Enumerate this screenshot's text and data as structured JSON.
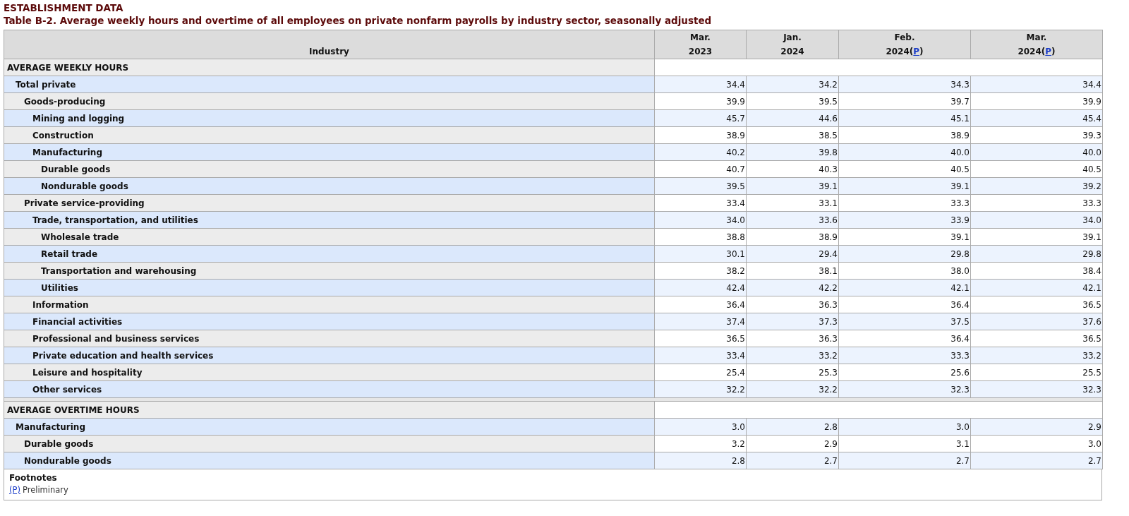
{
  "heading": "ESTABLISHMENT DATA",
  "title": "Table B-2. Average weekly hours and overtime of all employees on private nonfarm payrolls by industry sector, seasonally adjusted",
  "columns": [
    {
      "label": "Industry"
    },
    {
      "month": "Mar.",
      "year": "2023"
    },
    {
      "month": "Jan.",
      "year": "2024"
    },
    {
      "month": "Feb.",
      "year": "2024",
      "footnote": {
        "open": "(",
        "label": "P",
        "close": ")"
      }
    },
    {
      "month": "Mar.",
      "year": "2024",
      "footnote": {
        "open": "(",
        "label": "P",
        "close": ")"
      }
    }
  ],
  "sections": [
    {
      "title": "AVERAGE WEEKLY HOURS",
      "rows": [
        {
          "label": "Total private",
          "values": [
            "34.4",
            "34.2",
            "34.3",
            "34.4"
          ],
          "children": [
            {
              "label": "Goods-producing",
              "values": [
                "39.9",
                "39.5",
                "39.7",
                "39.9"
              ],
              "children": [
                {
                  "label": "Mining and logging",
                  "values": [
                    "45.7",
                    "44.6",
                    "45.1",
                    "45.4"
                  ]
                },
                {
                  "label": "Construction",
                  "values": [
                    "38.9",
                    "38.5",
                    "38.9",
                    "39.3"
                  ]
                },
                {
                  "label": "Manufacturing",
                  "values": [
                    "40.2",
                    "39.8",
                    "40.0",
                    "40.0"
                  ],
                  "children": [
                    {
                      "label": "Durable goods",
                      "values": [
                        "40.7",
                        "40.3",
                        "40.5",
                        "40.5"
                      ]
                    },
                    {
                      "label": "Nondurable goods",
                      "values": [
                        "39.5",
                        "39.1",
                        "39.1",
                        "39.2"
                      ]
                    }
                  ]
                }
              ]
            },
            {
              "label": "Private service-providing",
              "values": [
                "33.4",
                "33.1",
                "33.3",
                "33.3"
              ],
              "children": [
                {
                  "label": "Trade, transportation, and utilities",
                  "values": [
                    "34.0",
                    "33.6",
                    "33.9",
                    "34.0"
                  ],
                  "children": [
                    {
                      "label": "Wholesale trade",
                      "values": [
                        "38.8",
                        "38.9",
                        "39.1",
                        "39.1"
                      ]
                    },
                    {
                      "label": "Retail trade",
                      "values": [
                        "30.1",
                        "29.4",
                        "29.8",
                        "29.8"
                      ]
                    },
                    {
                      "label": "Transportation and warehousing",
                      "values": [
                        "38.2",
                        "38.1",
                        "38.0",
                        "38.4"
                      ]
                    },
                    {
                      "label": "Utilities",
                      "values": [
                        "42.4",
                        "42.2",
                        "42.1",
                        "42.1"
                      ]
                    }
                  ]
                },
                {
                  "label": "Information",
                  "values": [
                    "36.4",
                    "36.3",
                    "36.4",
                    "36.5"
                  ]
                },
                {
                  "label": "Financial activities",
                  "values": [
                    "37.4",
                    "37.3",
                    "37.5",
                    "37.6"
                  ]
                },
                {
                  "label": "Professional and business services",
                  "values": [
                    "36.5",
                    "36.3",
                    "36.4",
                    "36.5"
                  ]
                },
                {
                  "label": "Private education and health services",
                  "values": [
                    "33.4",
                    "33.2",
                    "33.3",
                    "33.2"
                  ]
                },
                {
                  "label": "Leisure and hospitality",
                  "values": [
                    "25.4",
                    "25.3",
                    "25.6",
                    "25.5"
                  ]
                },
                {
                  "label": "Other services",
                  "values": [
                    "32.2",
                    "32.2",
                    "32.3",
                    "32.3"
                  ]
                }
              ]
            }
          ]
        }
      ]
    },
    {
      "title": "AVERAGE OVERTIME HOURS",
      "rows": [
        {
          "label": "Manufacturing",
          "values": [
            "3.0",
            "2.8",
            "3.0",
            "2.9"
          ],
          "children": [
            {
              "label": "Durable goods",
              "values": [
                "3.2",
                "2.9",
                "3.1",
                "3.0"
              ]
            },
            {
              "label": "Nondurable goods",
              "values": [
                "2.8",
                "2.7",
                "2.7",
                "2.7"
              ]
            }
          ]
        }
      ]
    }
  ],
  "footnotes": {
    "title": "Footnotes",
    "items": [
      {
        "mark": "(P)",
        "text": "Preliminary"
      }
    ]
  }
}
